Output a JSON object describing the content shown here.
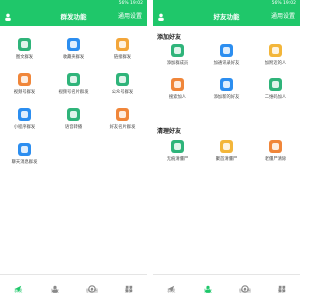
{
  "status_text": "56% 19:02",
  "left": {
    "title": "群发功能",
    "right_action": "通用设置",
    "tiles": [
      {
        "label": "图文群发",
        "color": "#2fb47a"
      },
      {
        "label": "收藏夹群发",
        "color": "#2c8ef0"
      },
      {
        "label": "链接群发",
        "color": "#f3a63a"
      },
      {
        "label": "视频号群发",
        "color": "#f0863a"
      },
      {
        "label": "视频号名片群发",
        "color": "#2fb47a"
      },
      {
        "label": "公众号群发",
        "color": "#2fb47a"
      },
      {
        "label": "小程序群发",
        "color": "#2c8ef0"
      },
      {
        "label": "语音转播",
        "color": "#2fb47a"
      },
      {
        "label": "好友名片群发",
        "color": "#f0863a"
      },
      {
        "label": "聊天消息群发",
        "color": "#2c8ef0"
      }
    ]
  },
  "right": {
    "title": "好友功能",
    "right_action": "通用设置",
    "section1": "添加好友",
    "section1_tiles": [
      {
        "label": "添加群成员",
        "color": "#2fb47a"
      },
      {
        "label": "加通讯录好友",
        "color": "#2c8ef0"
      },
      {
        "label": "加附近的人",
        "color": "#f3b63a"
      },
      {
        "label": "搜索加人",
        "color": "#f0863a"
      },
      {
        "label": "添加新的好友",
        "color": "#2c8ef0"
      },
      {
        "label": "二维码加人",
        "color": "#2fb47a"
      }
    ],
    "section2": "清理好友",
    "section2_tiles": [
      {
        "label": "无痕清僵尸",
        "color": "#2fb47a"
      },
      {
        "label": "聚首清僵尸",
        "color": "#f3b63a"
      },
      {
        "label": "老僵尸清除",
        "color": "#f0863a"
      }
    ]
  },
  "tabs": [
    {
      "label": "群发",
      "icon": "send-icon"
    },
    {
      "label": "好友",
      "icon": "person-icon"
    },
    {
      "label": "朋友圈",
      "icon": "moments-icon"
    },
    {
      "label": "更多",
      "icon": "grid-icon"
    }
  ],
  "left_active_tab": 0,
  "right_active_tab": 1,
  "accent": "#1fc76a"
}
